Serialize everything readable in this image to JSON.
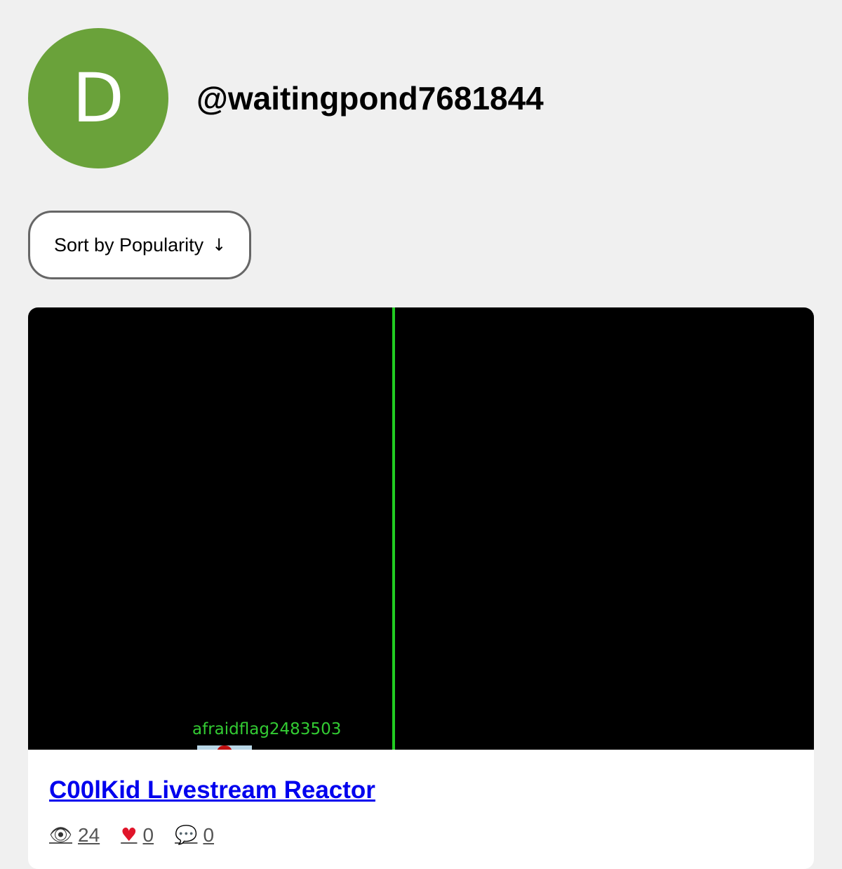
{
  "profile": {
    "avatar_letter": "D",
    "avatar_color": "#6aa23a",
    "username": "@waitingpond7681844"
  },
  "sort": {
    "label": "Sort by Popularity",
    "direction_icon": "↓"
  },
  "video": {
    "thumbnail_label": "afraidflag2483503",
    "title": "C00lKid Livestream Reactor",
    "stats": {
      "views": "24",
      "likes": "0",
      "comments": "0"
    },
    "icons": {
      "views": "eye-icon",
      "likes": "heart-icon",
      "comments": "comment-icon"
    }
  }
}
